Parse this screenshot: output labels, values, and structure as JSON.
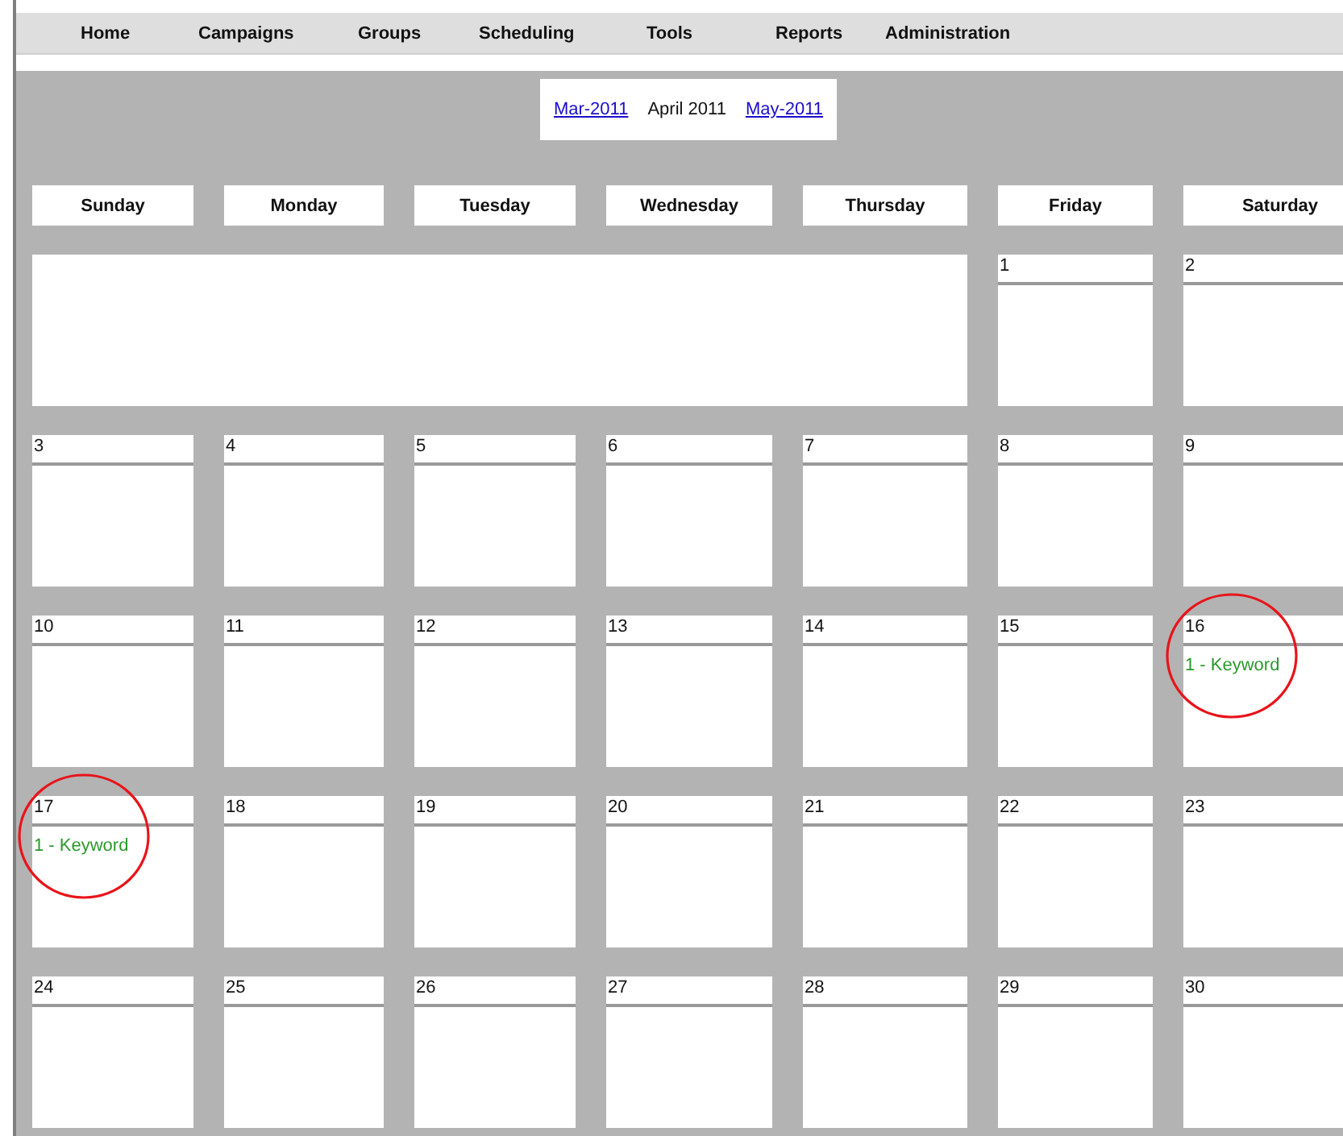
{
  "menu": [
    "Home",
    "Campaigns",
    "Groups",
    "Scheduling",
    "Tools",
    "Reports",
    "Administration"
  ],
  "month_nav": {
    "previous": "Mar-2011",
    "current": "April 2011",
    "next": "May-2011"
  },
  "weekdays": [
    "Sunday",
    "Monday",
    "Tuesday",
    "Wednesday",
    "Thursday",
    "Friday",
    "Saturday"
  ],
  "weeks": [
    [
      {
        "day": "1",
        "circled": false
      },
      {
        "day": "2",
        "circled": false
      }
    ],
    [
      {
        "day": "3",
        "circled": false
      },
      {
        "day": "4",
        "circled": false
      },
      {
        "day": "5",
        "circled": false
      },
      {
        "day": "6",
        "circled": false
      },
      {
        "day": "7",
        "circled": false
      },
      {
        "day": "8",
        "circled": false
      },
      {
        "day": "9",
        "circled": false
      }
    ],
    [
      {
        "day": "10",
        "circled": false
      },
      {
        "day": "11",
        "circled": false
      },
      {
        "day": "12",
        "circled": false
      },
      {
        "day": "13",
        "circled": false
      },
      {
        "day": "14",
        "circled": false
      },
      {
        "day": "15",
        "circled": false
      },
      {
        "day": "16",
        "events": [
          "1 - Keyword"
        ],
        "circled": true
      }
    ],
    [
      {
        "day": "17",
        "events": [
          "1 - Keyword"
        ],
        "circled": true
      },
      {
        "day": "18",
        "circled": false
      },
      {
        "day": "19",
        "circled": false
      },
      {
        "day": "20",
        "circled": false
      },
      {
        "day": "21",
        "circled": false
      },
      {
        "day": "22",
        "circled": false
      },
      {
        "day": "23",
        "circled": false
      }
    ],
    [
      {
        "day": "24",
        "circled": false
      },
      {
        "day": "25",
        "circled": false
      },
      {
        "day": "26",
        "circled": false
      },
      {
        "day": "27",
        "circled": false
      },
      {
        "day": "28",
        "circled": false
      },
      {
        "day": "29",
        "circled": false
      },
      {
        "day": "30",
        "circled": false
      }
    ]
  ]
}
